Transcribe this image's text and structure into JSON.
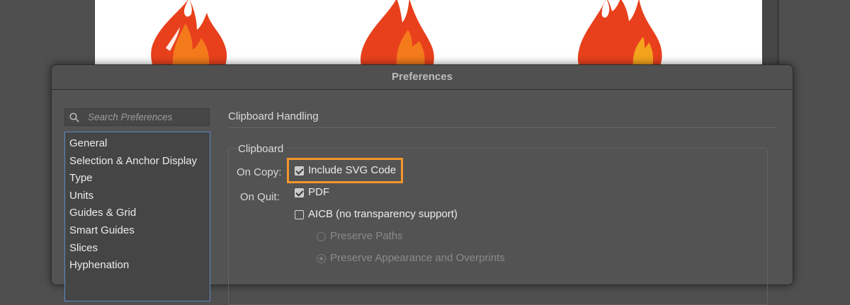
{
  "window": {
    "title": "Preferences"
  },
  "search": {
    "placeholder": "Search Preferences"
  },
  "categories": [
    "General",
    "Selection & Anchor Display",
    "Type",
    "Units",
    "Guides & Grid",
    "Smart Guides",
    "Slices",
    "Hyphenation"
  ],
  "panel": {
    "title": "Clipboard Handling",
    "group_title": "Clipboard",
    "on_copy_label": "On Copy:",
    "on_quit_label": "On Quit:",
    "include_svg": {
      "label": "Include SVG Code",
      "checked": true
    },
    "pdf": {
      "label": "PDF",
      "checked": true
    },
    "aicb": {
      "label": "AICB (no transparency support)",
      "checked": false
    },
    "preserve_paths": {
      "label": "Preserve Paths",
      "selected": false,
      "disabled": true
    },
    "preserve_appearance": {
      "label": "Preserve Appearance and Overprints",
      "selected": true,
      "disabled": true
    }
  },
  "colors": {
    "highlight": "#f2972a",
    "list_border": "#5b87c4",
    "flame_red": "#e8401c",
    "flame_orange": "#f47a1c"
  }
}
